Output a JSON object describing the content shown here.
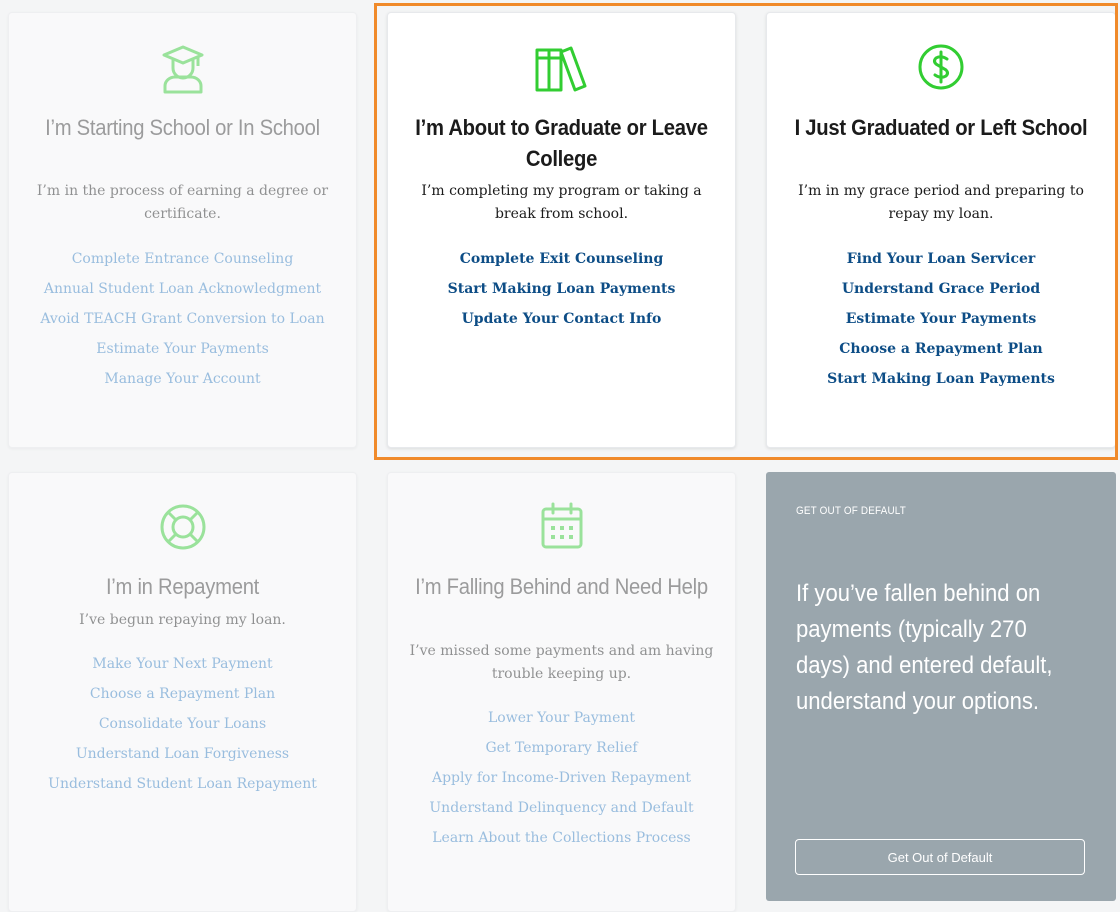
{
  "colors": {
    "icon_green": "#32cd32",
    "link_blue": "#0d4d86",
    "highlight_orange": "#f08a2b",
    "default_card_bg": "#9aa6ad"
  },
  "cards": [
    {
      "icon": "graduate-icon",
      "title": "I’m Starting School or In School",
      "description": "I’m in the process of earning a degree or certificate.",
      "links": [
        "Complete Entrance Counseling",
        "Annual Student Loan Acknowledgment",
        "Avoid TEACH Grant Conversion to Loan",
        "Estimate Your Payments",
        "Manage Your Account"
      ]
    },
    {
      "icon": "books-icon",
      "title": "I’m About to Graduate or Leave College",
      "description": "I’m completing my program or taking a break from school.",
      "links": [
        "Complete Exit Counseling",
        "Start Making Loan Payments",
        "Update Your Contact Info"
      ]
    },
    {
      "icon": "dollar-circle-icon",
      "title": "I Just Graduated or Left School",
      "description": "I’m in my grace period and preparing to repay my loan.",
      "links": [
        "Find Your Loan Servicer",
        "Understand Grace Period",
        "Estimate Your Payments",
        "Choose a Repayment Plan",
        "Start Making Loan Payments"
      ]
    },
    {
      "icon": "lifebuoy-icon",
      "title": "I’m in Repayment",
      "description": "I’ve begun repaying my loan.",
      "links": [
        "Make Your Next Payment",
        "Choose a Repayment Plan",
        "Consolidate Your Loans",
        "Understand Loan Forgiveness",
        "Understand Student Loan Repayment"
      ]
    },
    {
      "icon": "calendar-icon",
      "title": "I’m Falling Behind and Need Help",
      "description": "I’ve missed some payments and am having trouble keeping up.",
      "links": [
        "Lower Your Payment",
        "Get Temporary Relief",
        "Apply for Income-Driven Repayment",
        "Understand Delinquency and Default",
        "Learn About the Collections Process"
      ]
    }
  ],
  "default_card": {
    "kicker": "GET OUT OF DEFAULT",
    "text": "If you’ve fallen behind on payments (typically 270 days) and entered default, understand your options.",
    "button": "Get Out of Default"
  }
}
